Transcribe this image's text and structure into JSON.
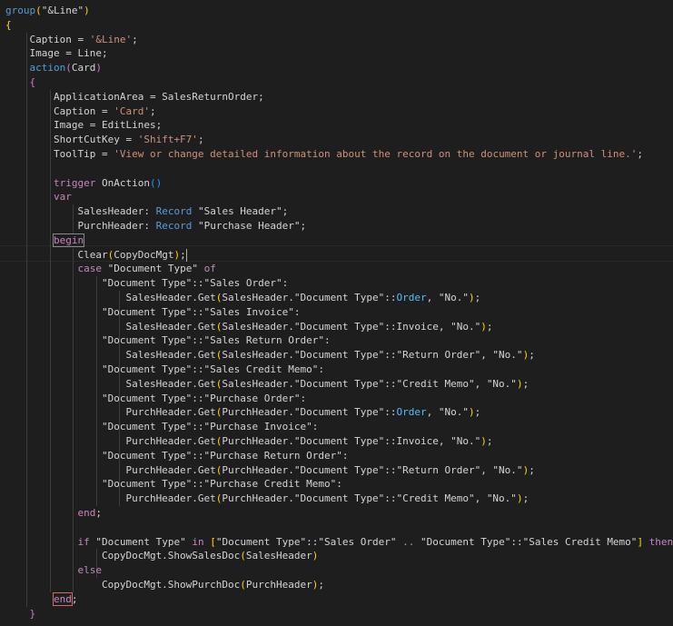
{
  "colors": {
    "background": "#1e1e1e",
    "text": "#d4d4d4",
    "keyword": "#c586c0",
    "function": "#569cd6",
    "string": "#ce9178",
    "bracket_level_1": "#ffd700",
    "bracket_level_2": "#da70d6",
    "bracket_level_3": "#179fff",
    "enum_member": "#4fc1ff"
  },
  "editor": {
    "lines": [
      {
        "tokens": [
          {
            "t": "group",
            "c": "fn"
          },
          {
            "t": "(",
            "c": "par"
          },
          {
            "t": "\"&Line\"",
            "c": "id"
          },
          {
            "t": ")",
            "c": "par"
          }
        ]
      },
      {
        "tokens": [
          {
            "t": "{",
            "c": "par"
          }
        ]
      },
      {
        "tokens": [
          {
            "t": "    Caption = ",
            "c": "id"
          },
          {
            "t": "'&Line'",
            "c": "str"
          },
          {
            "t": ";",
            "c": "id"
          }
        ]
      },
      {
        "tokens": [
          {
            "t": "    Image = Line;",
            "c": "id"
          }
        ]
      },
      {
        "tokens": [
          {
            "t": "    ",
            "c": "id"
          },
          {
            "t": "action",
            "c": "fn"
          },
          {
            "t": "(",
            "c": "par2"
          },
          {
            "t": "Card",
            "c": "id"
          },
          {
            "t": ")",
            "c": "par2"
          }
        ]
      },
      {
        "tokens": [
          {
            "t": "    ",
            "c": "id"
          },
          {
            "t": "{",
            "c": "par2"
          }
        ]
      },
      {
        "tokens": [
          {
            "t": "        ApplicationArea = SalesReturnOrder;",
            "c": "id"
          }
        ]
      },
      {
        "tokens": [
          {
            "t": "        Caption = ",
            "c": "id"
          },
          {
            "t": "'Card'",
            "c": "str"
          },
          {
            "t": ";",
            "c": "id"
          }
        ]
      },
      {
        "tokens": [
          {
            "t": "        Image = EditLines;",
            "c": "id"
          }
        ]
      },
      {
        "tokens": [
          {
            "t": "        ShortCutKey = ",
            "c": "id"
          },
          {
            "t": "'Shift+F7'",
            "c": "str"
          },
          {
            "t": ";",
            "c": "id"
          }
        ]
      },
      {
        "tokens": [
          {
            "t": "        ToolTip = ",
            "c": "id"
          },
          {
            "t": "'View or change detailed information about the record on the document or journal line.'",
            "c": "str"
          },
          {
            "t": ";",
            "c": "id"
          }
        ]
      },
      {
        "tokens": []
      },
      {
        "tokens": [
          {
            "t": "        ",
            "c": "id"
          },
          {
            "t": "trigger",
            "c": "kw"
          },
          {
            "t": " OnAction",
            "c": "id"
          },
          {
            "t": "()",
            "c": "par3"
          }
        ]
      },
      {
        "tokens": [
          {
            "t": "        ",
            "c": "id"
          },
          {
            "t": "var",
            "c": "kw"
          }
        ]
      },
      {
        "tokens": [
          {
            "t": "            SalesHeader: ",
            "c": "id"
          },
          {
            "t": "Record",
            "c": "fn"
          },
          {
            "t": " \"Sales Header\";",
            "c": "id"
          }
        ]
      },
      {
        "tokens": [
          {
            "t": "            PurchHeader: ",
            "c": "id"
          },
          {
            "t": "Record",
            "c": "fn"
          },
          {
            "t": " \"Purchase Header\";",
            "c": "id"
          }
        ]
      },
      {
        "tokens": [
          {
            "t": "        ",
            "c": "id"
          },
          {
            "t": "begin",
            "c": "kw",
            "box": "grey"
          }
        ]
      },
      {
        "tokens": [
          {
            "t": "            Clear",
            "c": "id"
          },
          {
            "t": "(",
            "c": "par"
          },
          {
            "t": "CopyDocMgt",
            "c": "id"
          },
          {
            "t": ")",
            "c": "par"
          },
          {
            "t": ";",
            "c": "id"
          },
          {
            "t": "",
            "c": "cursor"
          }
        ]
      },
      {
        "tokens": [
          {
            "t": "            ",
            "c": "id"
          },
          {
            "t": "case",
            "c": "kw"
          },
          {
            "t": " \"Document Type\" ",
            "c": "id"
          },
          {
            "t": "of",
            "c": "kw"
          }
        ]
      },
      {
        "tokens": [
          {
            "t": "                \"Document Type\"::\"Sales Order\":",
            "c": "id"
          }
        ]
      },
      {
        "tokens": [
          {
            "t": "                    SalesHeader.Get",
            "c": "id"
          },
          {
            "t": "(",
            "c": "par"
          },
          {
            "t": "SalesHeader.\"Document Type\"::",
            "c": "id"
          },
          {
            "t": "Order",
            "c": "enum"
          },
          {
            "t": ", \"No.\"",
            "c": "id"
          },
          {
            "t": ")",
            "c": "par"
          },
          {
            "t": ";",
            "c": "id"
          }
        ]
      },
      {
        "tokens": [
          {
            "t": "                \"Document Type\"::\"Sales Invoice\":",
            "c": "id"
          }
        ]
      },
      {
        "tokens": [
          {
            "t": "                    SalesHeader.Get",
            "c": "id"
          },
          {
            "t": "(",
            "c": "par"
          },
          {
            "t": "SalesHeader.\"Document Type\"::Invoice, \"No.\"",
            "c": "id"
          },
          {
            "t": ")",
            "c": "par"
          },
          {
            "t": ";",
            "c": "id"
          }
        ]
      },
      {
        "tokens": [
          {
            "t": "                \"Document Type\"::\"Sales Return Order\":",
            "c": "id"
          }
        ]
      },
      {
        "tokens": [
          {
            "t": "                    SalesHeader.Get",
            "c": "id"
          },
          {
            "t": "(",
            "c": "par"
          },
          {
            "t": "SalesHeader.\"Document Type\"::\"Return Order\", \"No.\"",
            "c": "id"
          },
          {
            "t": ")",
            "c": "par"
          },
          {
            "t": ";",
            "c": "id"
          }
        ]
      },
      {
        "tokens": [
          {
            "t": "                \"Document Type\"::\"Sales Credit Memo\":",
            "c": "id"
          }
        ]
      },
      {
        "tokens": [
          {
            "t": "                    SalesHeader.Get",
            "c": "id"
          },
          {
            "t": "(",
            "c": "par"
          },
          {
            "t": "SalesHeader.\"Document Type\"::\"Credit Memo\", \"No.\"",
            "c": "id"
          },
          {
            "t": ")",
            "c": "par"
          },
          {
            "t": ";",
            "c": "id"
          }
        ]
      },
      {
        "tokens": [
          {
            "t": "                \"Document Type\"::\"Purchase Order\":",
            "c": "id"
          }
        ]
      },
      {
        "tokens": [
          {
            "t": "                    PurchHeader.Get",
            "c": "id"
          },
          {
            "t": "(",
            "c": "par"
          },
          {
            "t": "PurchHeader.\"Document Type\"::",
            "c": "id"
          },
          {
            "t": "Order",
            "c": "enum"
          },
          {
            "t": ", \"No.\"",
            "c": "id"
          },
          {
            "t": ")",
            "c": "par"
          },
          {
            "t": ";",
            "c": "id"
          }
        ]
      },
      {
        "tokens": [
          {
            "t": "                \"Document Type\"::\"Purchase Invoice\":",
            "c": "id"
          }
        ]
      },
      {
        "tokens": [
          {
            "t": "                    PurchHeader.Get",
            "c": "id"
          },
          {
            "t": "(",
            "c": "par"
          },
          {
            "t": "PurchHeader.\"Document Type\"::Invoice, \"No.\"",
            "c": "id"
          },
          {
            "t": ")",
            "c": "par"
          },
          {
            "t": ";",
            "c": "id"
          }
        ]
      },
      {
        "tokens": [
          {
            "t": "                \"Document Type\"::\"Purchase Return Order\":",
            "c": "id"
          }
        ]
      },
      {
        "tokens": [
          {
            "t": "                    PurchHeader.Get",
            "c": "id"
          },
          {
            "t": "(",
            "c": "par"
          },
          {
            "t": "PurchHeader.\"Document Type\"::\"Return Order\", \"No.\"",
            "c": "id"
          },
          {
            "t": ")",
            "c": "par"
          },
          {
            "t": ";",
            "c": "id"
          }
        ]
      },
      {
        "tokens": [
          {
            "t": "                \"Document Type\"::\"Purchase Credit Memo\":",
            "c": "id"
          }
        ]
      },
      {
        "tokens": [
          {
            "t": "                    PurchHeader.Get",
            "c": "id"
          },
          {
            "t": "(",
            "c": "par"
          },
          {
            "t": "PurchHeader.\"Document Type\"::\"Credit Memo\", \"No.\"",
            "c": "id"
          },
          {
            "t": ")",
            "c": "par"
          },
          {
            "t": ";",
            "c": "id"
          }
        ]
      },
      {
        "tokens": [
          {
            "t": "            ",
            "c": "id"
          },
          {
            "t": "end",
            "c": "kw"
          },
          {
            "t": ";",
            "c": "id"
          }
        ]
      },
      {
        "tokens": []
      },
      {
        "tokens": [
          {
            "t": "            ",
            "c": "id"
          },
          {
            "t": "if",
            "c": "kw"
          },
          {
            "t": " \"Document Type\" ",
            "c": "id"
          },
          {
            "t": "in",
            "c": "kw"
          },
          {
            "t": " ",
            "c": "id"
          },
          {
            "t": "[",
            "c": "par"
          },
          {
            "t": "\"Document Type\"::\"Sales Order\" ",
            "c": "id"
          },
          {
            "t": "..",
            "c": "kw"
          },
          {
            "t": " \"Document Type\"::\"Sales Credit Memo\"",
            "c": "id"
          },
          {
            "t": "]",
            "c": "par"
          },
          {
            "t": " ",
            "c": "id"
          },
          {
            "t": "then",
            "c": "kw"
          }
        ]
      },
      {
        "tokens": [
          {
            "t": "                CopyDocMgt.ShowSalesDoc",
            "c": "id"
          },
          {
            "t": "(",
            "c": "par"
          },
          {
            "t": "SalesHeader",
            "c": "id"
          },
          {
            "t": ")",
            "c": "par"
          }
        ]
      },
      {
        "tokens": [
          {
            "t": "            ",
            "c": "id"
          },
          {
            "t": "else",
            "c": "kw"
          }
        ]
      },
      {
        "tokens": [
          {
            "t": "                CopyDocMgt.ShowPurchDoc",
            "c": "id"
          },
          {
            "t": "(",
            "c": "par"
          },
          {
            "t": "PurchHeader",
            "c": "id"
          },
          {
            "t": ")",
            "c": "par"
          },
          {
            "t": ";",
            "c": "id"
          }
        ]
      },
      {
        "tokens": [
          {
            "t": "        ",
            "c": "id"
          },
          {
            "t": "end",
            "c": "kw",
            "box": "red"
          },
          {
            "t": ";",
            "c": "id"
          }
        ]
      },
      {
        "tokens": [
          {
            "t": "    ",
            "c": "id"
          },
          {
            "t": "}",
            "c": "par2"
          }
        ]
      }
    ]
  }
}
